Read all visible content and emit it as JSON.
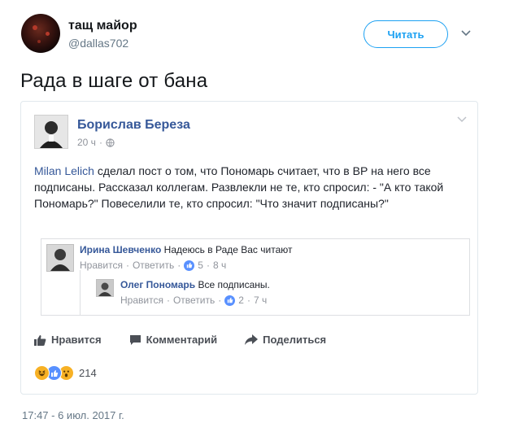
{
  "tweet": {
    "display_name": "тащ майор",
    "handle": "@dallas702",
    "follow_label": "Читать",
    "text": "Рада в шаге от бана",
    "timestamp": "17:47 - 6 июл. 2017 г."
  },
  "fb_post": {
    "author": "Борислав Береза",
    "time": "20 ч",
    "body_link": "Milan Lelich",
    "body_text": " сделал пост о том, что Пономарь считает, что в ВР на него все подписаны. Рассказал коллегам. Развлекли не те, кто спросил: - \"А кто такой Пономарь?\" Повеселили те, кто спросил: \"Что значит подписаны?\"",
    "comments": [
      {
        "author": "Ирина Шевченко",
        "text": "Надеюсь в Раде Вас читают",
        "like_label": "Нравится",
        "reply_label": "Ответить",
        "likes": "5",
        "time": "8 ч"
      },
      {
        "author": "Олег Пономарь",
        "text": "Все подписаны.",
        "like_label": "Нравится",
        "reply_label": "Ответить",
        "likes": "2",
        "time": "7 ч"
      }
    ],
    "actions": {
      "like": "Нравится",
      "comment": "Комментарий",
      "share": "Поделиться"
    },
    "reactions_count": "214"
  },
  "icons": [
    "chevron-down-icon",
    "globe-icon",
    "thumbs-up-icon",
    "comment-icon",
    "share-icon",
    "haha-reaction-icon",
    "like-reaction-icon",
    "wow-reaction-icon"
  ],
  "colors": {
    "twitter_blue": "#1da1f2",
    "fb_link": "#365899",
    "muted": "#90949c"
  }
}
